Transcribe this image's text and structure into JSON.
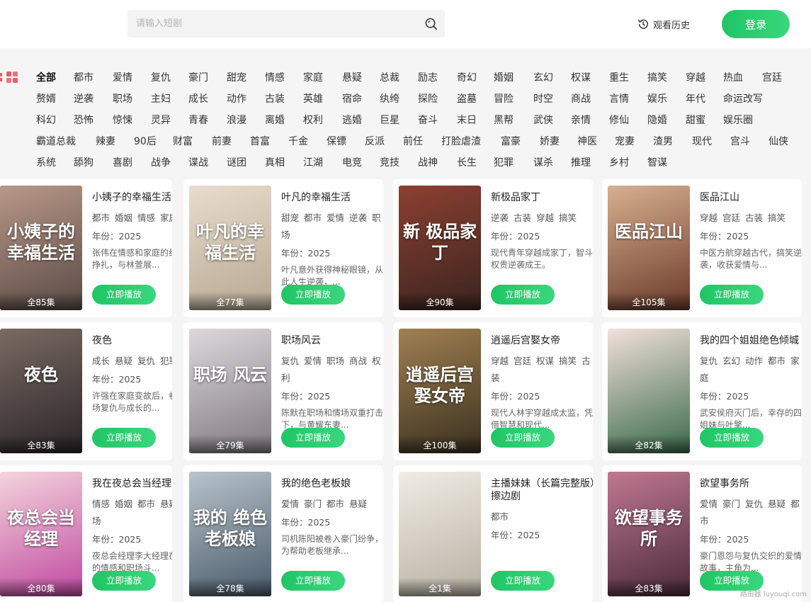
{
  "header": {
    "search_placeholder": "请输入短剧",
    "history_label": "观看历史",
    "login_label": "登录"
  },
  "categories": [
    "全部",
    "都市",
    "爱情",
    "复仇",
    "豪门",
    "甜宠",
    "情感",
    "家庭",
    "悬疑",
    "总裁",
    "励志",
    "奇幻",
    "婚姻",
    "玄幻",
    "权谋",
    "重生",
    "搞笑",
    "穿越",
    "热血",
    "宫廷",
    "赘婿",
    "逆袭",
    "职场",
    "主妇",
    "成长",
    "动作",
    "古装",
    "英雄",
    "宿命",
    "纨绔",
    "探险",
    "盗墓",
    "冒险",
    "时空",
    "商战",
    "言情",
    "娱乐",
    "年代",
    "命运改写",
    "科幻",
    "恐怖",
    "惊悚",
    "灵异",
    "青春",
    "浪漫",
    "离婚",
    "权利",
    "逃婚",
    "巨星",
    "奋斗",
    "末日",
    "黑帮",
    "武侠",
    "亲情",
    "修仙",
    "隐婚",
    "甜蜜",
    "娱乐圈",
    "霸道总裁",
    "辣妻",
    "90后",
    "财富",
    "前妻",
    "首富",
    "千金",
    "保镖",
    "反派",
    "前任",
    "打脸虐渣",
    "富豪",
    "娇妻",
    "神医",
    "宠妻",
    "渣男",
    "现代",
    "宫斗",
    "仙侠",
    "系统",
    "舔狗",
    "喜剧",
    "战争",
    "谍战",
    "谜团",
    "真相",
    "江湖",
    "电竞",
    "竞技",
    "战神",
    "长生",
    "犯罪",
    "谋杀",
    "推理",
    "乡村",
    "智谋"
  ],
  "colors": {
    "accent": "#20c565",
    "background": "#f5f5f5"
  },
  "play_label": "立即播放",
  "year_prefix": "年份：",
  "dramas": [
    {
      "title": "小姨子的幸福生活",
      "poster_text": "小姨子的幸福生活",
      "tags": [
        "都市",
        "婚姻",
        "情感",
        "家庭"
      ],
      "year": "2025",
      "desc": "张伟在情感和家庭的纠葛中挣扎，与林萱展...",
      "episodes": "全85集"
    },
    {
      "title": "叶凡的幸福生活",
      "poster_text": "叶凡的幸福生活",
      "tags": [
        "甜宠",
        "都市",
        "爱情",
        "逆袭",
        "职场"
      ],
      "year": "2025",
      "desc": "叶凡意外获得神秘眼镜，从此人生逆袭，...",
      "episodes": "全77集"
    },
    {
      "title": "新极品家丁",
      "poster_text": "新 极品家丁",
      "tags": [
        "逆袭",
        "古装",
        "穿越",
        "搞笑"
      ],
      "year": "2025",
      "desc": "现代青年穿越成家丁，智斗权贵逆袭成王。",
      "episodes": "全90集"
    },
    {
      "title": "医品江山",
      "poster_text": "医品江山",
      "tags": [
        "穿越",
        "宫廷",
        "古装",
        "搞笑"
      ],
      "year": "2025",
      "desc": "中医方航穿越古代，搞笑逆袭，收获爱情与...",
      "episodes": "全105集"
    },
    {
      "title": "夜色",
      "poster_text": "夜色",
      "tags": [
        "成长",
        "悬疑",
        "复仇",
        "犯罪"
      ],
      "year": "2025",
      "desc": "许强在家庭变故后，卷入一场复仇与成长的...",
      "episodes": "全83集"
    },
    {
      "title": "职场风云",
      "poster_text": "职场 风云",
      "tags": [
        "复仇",
        "爱情",
        "职场",
        "商战",
        "权利"
      ],
      "year": "2025",
      "desc": "陈默在职场和情场双重打击下，与黄耀东妻...",
      "episodes": "全79集"
    },
    {
      "title": "逍遥后宫娶女帝",
      "poster_text": "逍遥后宫娶女帝",
      "tags": [
        "穿越",
        "宫廷",
        "权谋",
        "搞笑",
        "古装"
      ],
      "year": "2025",
      "desc": "现代人林宇穿越成太监，凭借智慧和现代...",
      "episodes": "全100集"
    },
    {
      "title": "我的四个姐姐绝色倾城",
      "poster_text": "",
      "tags": [
        "复仇",
        "玄幻",
        "动作",
        "都市",
        "家庭"
      ],
      "year": "2025",
      "desc": "武安侯府灭门后，幸存的四姐妹与叶擎...",
      "episodes": "全82集"
    },
    {
      "title": "我在夜总会当经理",
      "poster_text": "夜总会当经理",
      "tags": [
        "情感",
        "婚姻",
        "都市",
        "悬疑",
        "职场"
      ],
      "year": "2025",
      "desc": "夜总会经理李大经理在复杂的情感和职场斗...",
      "episodes": "全80集"
    },
    {
      "title": "我的绝色老板娘",
      "poster_text": "我的 绝色老板娘",
      "tags": [
        "爱情",
        "豪门",
        "都市",
        "悬疑"
      ],
      "year": "2025",
      "desc": "司机陈阳被卷入豪门纷争，为帮助老板继承...",
      "episodes": "全78集"
    },
    {
      "title": "主播妹妹（长篇完整版）擦边剧",
      "poster_text": "",
      "tags": [
        "都市"
      ],
      "year": "2025",
      "desc": "",
      "episodes": "全1集"
    },
    {
      "title": "欲望事务所",
      "poster_text": "欲望事务所",
      "tags": [
        "爱情",
        "豪门",
        "复仇",
        "悬疑",
        "都市"
      ],
      "year": "2025",
      "desc": "豪门恩怨与复仇交织的爱情故事，主角为...",
      "episodes": "全83集"
    }
  ],
  "watermark": "路由器\nluyouqi.com"
}
